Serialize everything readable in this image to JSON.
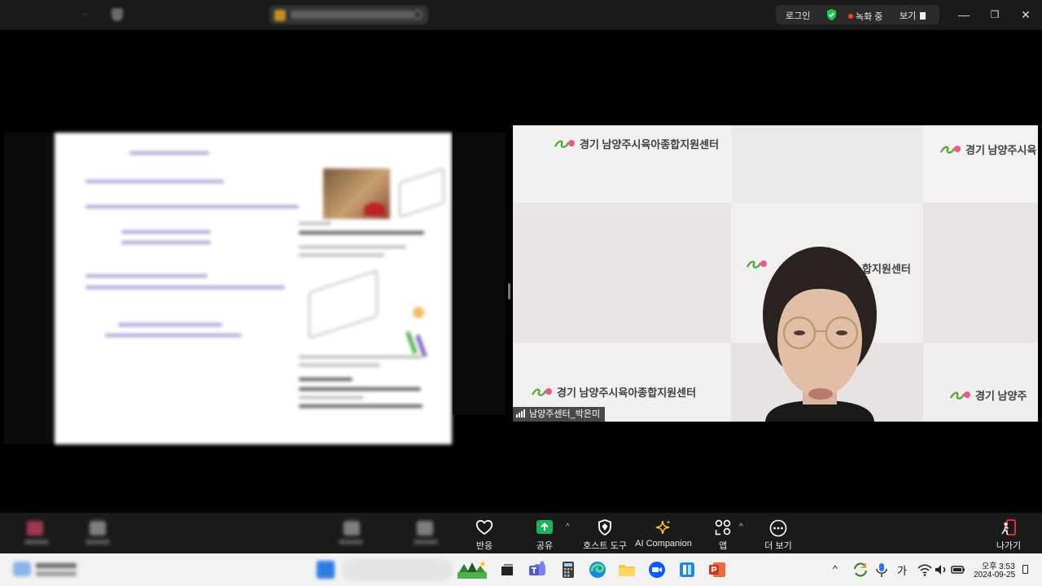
{
  "top_bar": {
    "login_label": "로그인",
    "recording_label": "녹화 중",
    "view_label": "보기",
    "window_controls": {
      "minimize": "—",
      "maximize": "❐",
      "close": "✕"
    }
  },
  "video": {
    "participant_name": "남양주센터_박은미",
    "watermark_text": "경기 남양주시육아종합지원센터",
    "watermark_partial": "경기 남양주시육",
    "watermark_partial2": "합지원센터",
    "watermark_partial3": "경기 남양주"
  },
  "toolbar": {
    "reactions_label": "반응",
    "share_label": "공유",
    "host_tools_label": "호스트 도구",
    "ai_companion_label": "AI Companion",
    "apps_label": "앱",
    "more_label": "더 보기",
    "leave_label": "나가기",
    "accent_share": "#18b55a",
    "leave_color": "#e53935"
  },
  "taskbar": {
    "ime_label": "가",
    "time": "오후 3:53",
    "date": "2024-09-25"
  }
}
